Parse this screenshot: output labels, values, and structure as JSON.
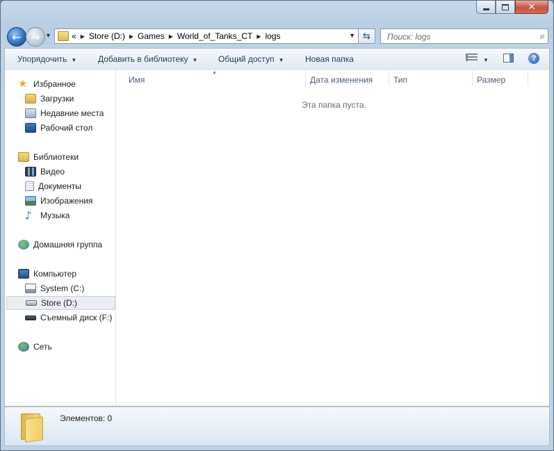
{
  "window": {
    "controls": {
      "minimize": "minimize",
      "maximize": "maximize",
      "close": "close"
    }
  },
  "address": {
    "overflow": "«",
    "crumbs": [
      "Store (D:)",
      "Games",
      "World_of_Tanks_CT",
      "logs"
    ]
  },
  "search": {
    "placeholder": "Поиск: logs"
  },
  "toolbar": {
    "organize": "Упорядочить",
    "add_library": "Добавить в библиотеку",
    "share": "Общий доступ",
    "new_folder": "Новая папка"
  },
  "nav": {
    "favorites": "Избранное",
    "downloads": "Загрузки",
    "recent": "Недавние места",
    "desktop": "Рабочий стол",
    "libraries": "Библиотеки",
    "video": "Видео",
    "documents": "Документы",
    "pictures": "Изображения",
    "music": "Музыка",
    "homegroup": "Домашняя группа",
    "computer": "Компьютер",
    "system": "System (C:)",
    "store": "Store (D:)",
    "removable": "Съемный диск (F:)",
    "network": "Сеть"
  },
  "columns": [
    "Имя",
    "Дата изменения",
    "Тип",
    "Размер"
  ],
  "empty_text": "Эта папка пуста.",
  "details": {
    "count_text": "Элементов: 0"
  },
  "colors": {
    "accent": "#1e395b",
    "selection": "#eaedf2",
    "window_frame": "#b8cde3"
  }
}
